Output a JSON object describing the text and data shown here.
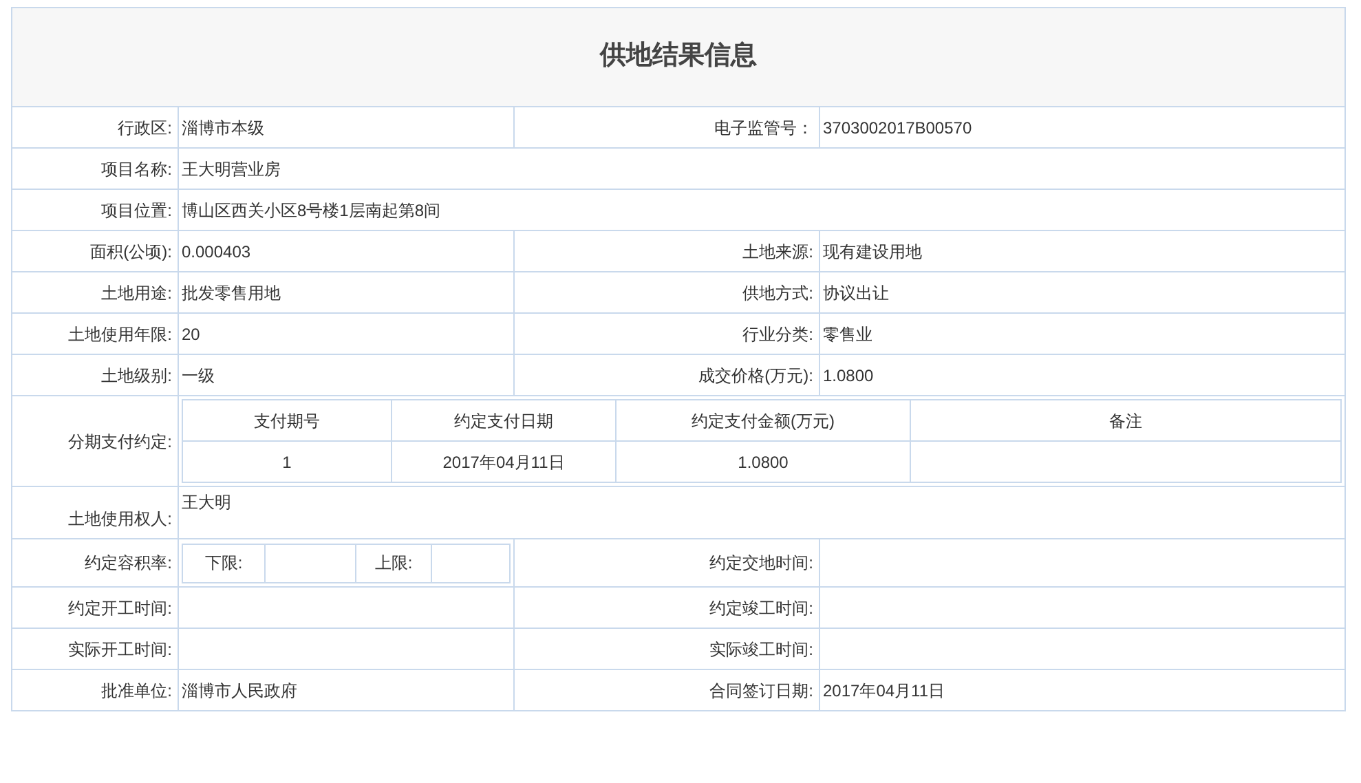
{
  "title": "供地结果信息",
  "rows": [
    {
      "kind": "pair",
      "fields": [
        {
          "label": "行政区:",
          "value": "淄博市本级"
        },
        {
          "label": "电子监管号：",
          "value": "3703002017B00570"
        }
      ]
    },
    {
      "kind": "full",
      "label": "项目名称:",
      "value": "王大明营业房"
    },
    {
      "kind": "full",
      "label": "项目位置:",
      "value": "博山区西关小区8号楼1层南起第8间"
    },
    {
      "kind": "pair",
      "fields": [
        {
          "label": "面积(公顷):",
          "value": "0.000403"
        },
        {
          "label": "土地来源:",
          "value": "现有建设用地"
        }
      ]
    },
    {
      "kind": "pair",
      "fields": [
        {
          "label": "土地用途:",
          "value": "批发零售用地"
        },
        {
          "label": "供地方式:",
          "value": "协议出让"
        }
      ]
    },
    {
      "kind": "pair",
      "fields": [
        {
          "label": "土地使用年限:",
          "value": "20"
        },
        {
          "label": "行业分类:",
          "value": "零售业"
        }
      ]
    },
    {
      "kind": "pair",
      "fields": [
        {
          "label": "土地级别:",
          "value": "一级"
        },
        {
          "label": "成交价格(万元):",
          "value": "1.0800"
        }
      ]
    },
    {
      "kind": "payments",
      "label": "分期支付约定:",
      "columns": [
        "支付期号",
        "约定支付日期",
        "约定支付金额(万元)",
        "备注"
      ],
      "rows": [
        [
          "1",
          "2017年04月11日",
          "1.0800"
        ]
      ]
    },
    {
      "kind": "owner",
      "label": "土地使用权人:",
      "value": "王大明"
    },
    {
      "kind": "far",
      "label": "约定容积率:",
      "lower_label": "下限:",
      "upper_label": "上限:",
      "right": {
        "label": "约定交地时间:"
      }
    },
    {
      "kind": "pair",
      "fields": [
        {
          "label": "约定开工时间:"
        },
        {
          "label": "约定竣工时间:"
        }
      ]
    },
    {
      "kind": "pair",
      "fields": [
        {
          "label": "实际开工时间:"
        },
        {
          "label": "实际竣工时间:"
        }
      ]
    },
    {
      "kind": "pair",
      "fields": [
        {
          "label": "批准单位:",
          "value": "淄博市人民政府"
        },
        {
          "label": "合同签订日期:",
          "value": "2017年04月11日"
        }
      ]
    }
  ]
}
